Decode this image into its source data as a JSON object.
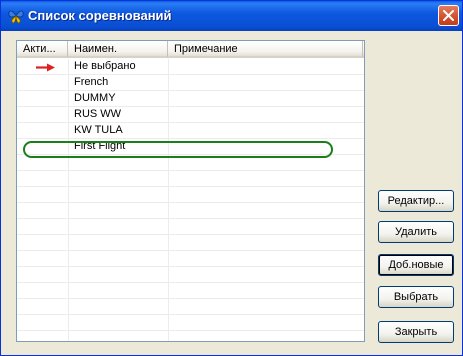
{
  "window": {
    "title": "Список соревнований",
    "icons": {
      "app": "butterfly-icon",
      "close": "close-x-icon"
    }
  },
  "list": {
    "columns": [
      "Акти...",
      "Наимен.",
      "Примечание"
    ],
    "rows": [
      {
        "active": true,
        "name": "Не выбрано",
        "note": ""
      },
      {
        "active": false,
        "name": "French",
        "note": ""
      },
      {
        "active": false,
        "name": "DUMMY",
        "note": ""
      },
      {
        "active": false,
        "name": "RUS WW",
        "note": ""
      },
      {
        "active": false,
        "name": "KW TULA",
        "note": ""
      },
      {
        "active": false,
        "name": "First Flight",
        "note": "",
        "highlighted": true
      }
    ],
    "marker_icon": "red-arrow-icon"
  },
  "buttons": {
    "edit": "Редактир...",
    "delete": "Удалить",
    "add_new": "Доб.новые",
    "select": "Выбрать",
    "close": "Закрыть"
  },
  "colors": {
    "titlebar": "#0a4fd3",
    "highlight_ring": "#1a7f1a",
    "marker": "#e02020"
  }
}
